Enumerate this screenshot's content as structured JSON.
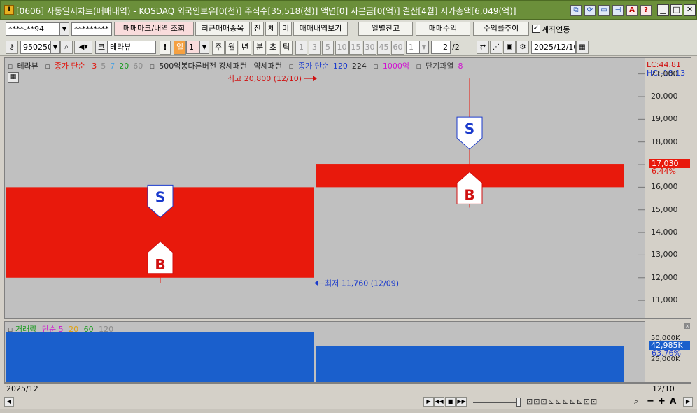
{
  "window": {
    "app_icon": "I",
    "title": "[0606] 자동일지차트(매매내역) - KOSDAQ 외국인보유[0(천)] 주식수[35,518(천)] 액면[0] 자본금[0(억)] 결산[4월] 시가총액[6,049(억)]",
    "minimize": "▁",
    "maximize": "□",
    "close": "✕"
  },
  "toolbar1": {
    "account": "****-**94",
    "password": "*********",
    "btn_trade_mark": "매매마크/내역 조회",
    "btn_recent": "최근매매종목",
    "btn_jan": "잔",
    "btn_che": "체",
    "btn_mi": "미",
    "btn_view": "매매내역보기",
    "btn_daily": "일별잔고",
    "btn_profit": "매매수익",
    "btn_rate": "수익률추이",
    "chk_label": "계좌연동",
    "chk_mark": "✓"
  },
  "toolbar2": {
    "code": "950250",
    "market": "코",
    "name": "테라뷰",
    "excl": "!",
    "period": "일",
    "period_num": "1",
    "units": [
      "주",
      "월",
      "년",
      "분",
      "초",
      "틱"
    ],
    "nums": [
      "1",
      "3",
      "5",
      "10",
      "15",
      "30",
      "45",
      "60"
    ],
    "num_sel": "1",
    "page": "2",
    "page_total": "/2",
    "date": "2025/12/10"
  },
  "legend": {
    "name": "테라뷰",
    "close_ma": "종가 단순",
    "ma": [
      "3",
      "5",
      "7",
      "20",
      "60"
    ],
    "pattern": "500억봉다른버전 강세패턴",
    "weak": "약세패턴",
    "close_ma2": "종가 단순",
    "ma2": [
      "120",
      "224"
    ],
    "eok": "1000억",
    "short": "단기과열",
    "short_n": "8"
  },
  "price_axis": {
    "lc": "LC:44.81",
    "hc": "HC:-18.13",
    "ticks": [
      "21,000",
      "20,000",
      "19,000",
      "18,000",
      "17,000",
      "16,000",
      "15,000",
      "14,000",
      "13,000",
      "12,000",
      "11,000"
    ],
    "current": "17,030",
    "change": "6.44%"
  },
  "annotations": {
    "high": "최고 20,800 (12/10)",
    "low": "최저 11,760 (12/09)",
    "sell_mark": "S",
    "buy_mark": "B"
  },
  "volume": {
    "label": "거래량",
    "ma_label": "단순",
    "ma": [
      "5",
      "20",
      "60",
      "120"
    ],
    "ticks": [
      "50,000K",
      "25,000K"
    ],
    "current": "42,985K",
    "change": "63.76%"
  },
  "date_axis": {
    "left": "2025/12",
    "right": "12/10"
  },
  "colors": {
    "up": "#e8190c",
    "volume": "#1a5fcc",
    "title_bar": "#6b8f3a"
  },
  "chart_data": {
    "type": "candlestick",
    "x": [
      "12/09",
      "12/10"
    ],
    "open": [
      12000,
      16000
    ],
    "high": [
      16000,
      20800
    ],
    "low": [
      11760,
      15100
    ],
    "close": [
      16000,
      17030
    ],
    "volume_k": [
      60000,
      42985
    ],
    "ylim": [
      10200,
      21700
    ],
    "ylim_volume_k": [
      0,
      72000
    ],
    "trades": [
      {
        "x": "12/09",
        "side": "sell"
      },
      {
        "x": "12/09",
        "side": "buy"
      },
      {
        "x": "12/10",
        "side": "sell"
      },
      {
        "x": "12/10",
        "side": "buy"
      }
    ]
  }
}
